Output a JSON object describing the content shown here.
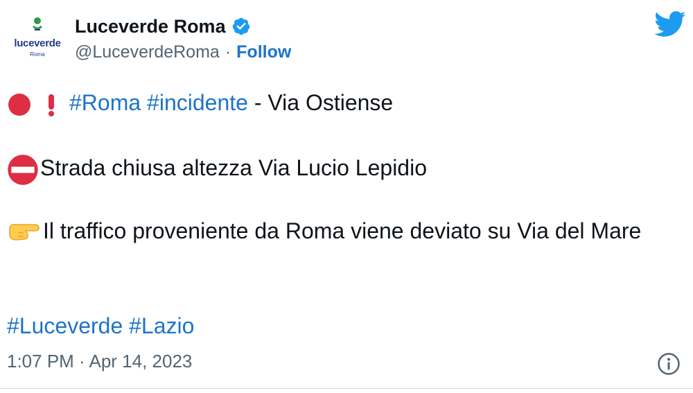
{
  "account": {
    "display_name": "Luceverde Roma",
    "handle": "@LuceverdeRoma",
    "separator": "·",
    "follow_label": "Follow",
    "avatar_brand": "luceverde",
    "avatar_sub": "Roma",
    "verified_color": "#1d9bf0"
  },
  "tweet": {
    "line1": {
      "hashtags": [
        "#Roma",
        "#incidente"
      ],
      "text": " - Via Ostiense",
      "emojis": [
        "red-circle-icon",
        "exclamation-icon"
      ]
    },
    "line2": {
      "text": "Strada chiusa altezza Via Lucio Lepidio",
      "emoji": "no-entry-icon"
    },
    "line3": {
      "text": "Il traffico proveniente da Roma viene deviato su Via del Mare",
      "emoji": "pointing-hand-icon"
    },
    "line4": {
      "hashtags": [
        "#Luceverde",
        "#Lazio"
      ]
    }
  },
  "footer": {
    "timestamp": "1:07 PM · Apr 14, 2023"
  },
  "colors": {
    "link": "#1d74c8",
    "twitter_blue": "#1d9bf0",
    "muted": "#536471",
    "red": "#dd2e44"
  },
  "icons": {
    "brand": "twitter-bird-icon",
    "info": "info-icon"
  }
}
